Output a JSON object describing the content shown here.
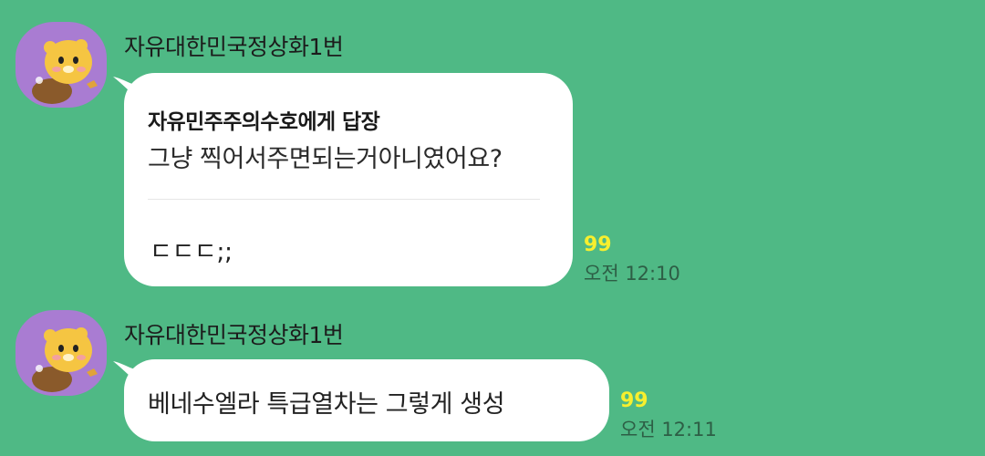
{
  "colors": {
    "background": "#4fb985",
    "bubble": "#ffffff",
    "read_count": "#f7ef2e",
    "avatar_bg": "#a97cd2"
  },
  "messages": [
    {
      "sender": "자유대한민국정상화1번",
      "avatar_icon": "bear-character-avatar-icon",
      "reply": {
        "title": "자유민주주의수호에게 답장",
        "quote": "그냥 찍어서주면되는거아니였어요?"
      },
      "text": "ㄷㄷㄷ;;",
      "read_count": "99",
      "time": "오전 12:10"
    },
    {
      "sender": "자유대한민국정상화1번",
      "avatar_icon": "bear-character-avatar-icon",
      "text": "베네수엘라 특급열차는 그렇게 생성",
      "read_count": "99",
      "time": "오전 12:11"
    }
  ]
}
